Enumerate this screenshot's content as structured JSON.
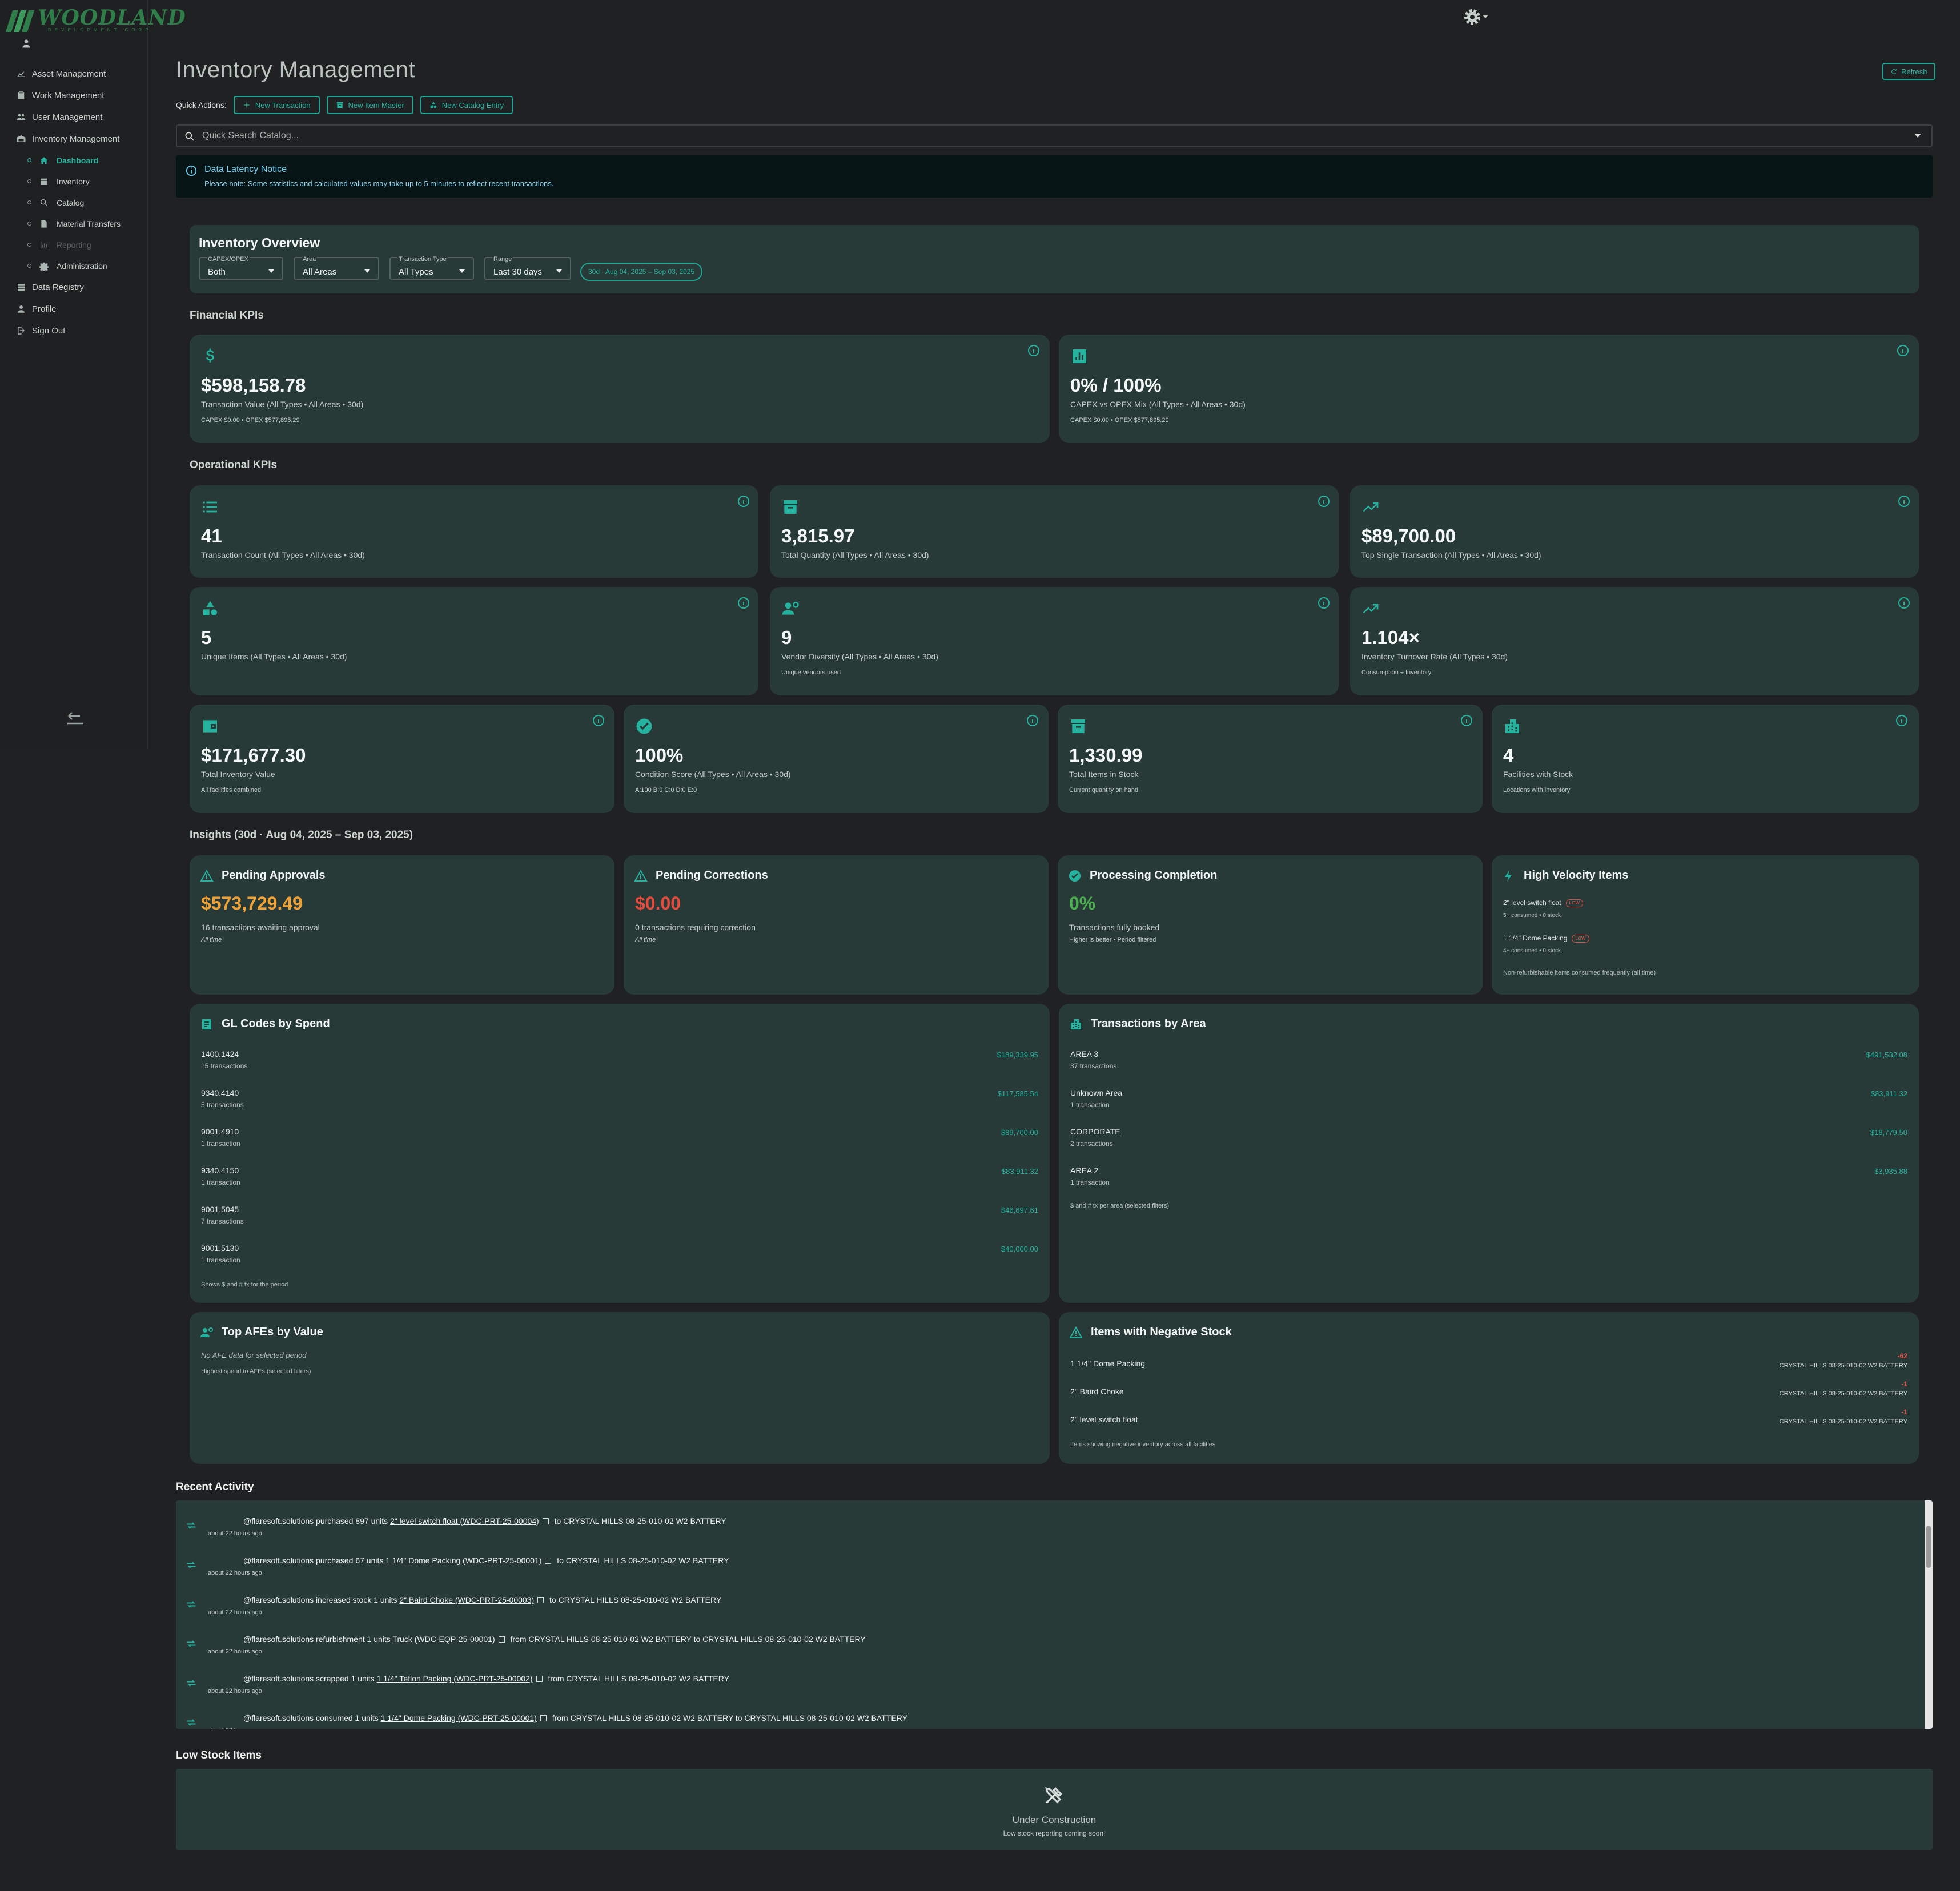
{
  "brand": {
    "name": "WOODLAND",
    "sub": "DEVELOPMENT CORP"
  },
  "sidebar": {
    "items": [
      {
        "label": "Asset Management",
        "icon": "asset-icon"
      },
      {
        "label": "Work Management",
        "icon": "clipboard-icon"
      },
      {
        "label": "User Management",
        "icon": "users-icon"
      },
      {
        "label": "Inventory Management",
        "icon": "warehouse-icon"
      }
    ],
    "sub": [
      {
        "label": "Dashboard",
        "icon": "home-icon",
        "state": "active"
      },
      {
        "label": "Inventory",
        "icon": "database-icon"
      },
      {
        "label": "Catalog",
        "icon": "search-icon"
      },
      {
        "label": "Material Transfers",
        "icon": "document-icon"
      },
      {
        "label": "Reporting",
        "icon": "chart-icon",
        "state": "disabled"
      },
      {
        "label": "Administration",
        "icon": "gear-icon"
      }
    ],
    "bottom": [
      {
        "label": "Data Registry",
        "icon": "database-icon"
      },
      {
        "label": "Profile",
        "icon": "user-icon"
      },
      {
        "label": "Sign Out",
        "icon": "logout-icon"
      }
    ]
  },
  "page": {
    "title": "Inventory Management",
    "refresh": "Refresh"
  },
  "quick_actions": {
    "label": "Quick Actions:",
    "buttons": [
      "New Transaction",
      "New Item Master",
      "New Catalog Entry"
    ]
  },
  "search": {
    "placeholder": "Quick Search Catalog..."
  },
  "notice": {
    "title": "Data Latency Notice",
    "text": "Please note: Some statistics and calculated values may take up to 5 minutes to reflect recent transactions."
  },
  "overview": {
    "title": "Inventory Overview",
    "filters": [
      {
        "label": "CAPEX/OPEX",
        "value": "Both"
      },
      {
        "label": "Area",
        "value": "All Areas"
      },
      {
        "label": "Transaction Type",
        "value": "All Types"
      },
      {
        "label": "Range",
        "value": "Last 30 days"
      }
    ],
    "chip": "30d · Aug 04, 2025 – Sep 03, 2025"
  },
  "sections": {
    "financial": "Financial KPIs",
    "operational": "Operational KPIs",
    "insights": "Insights (30d · Aug 04, 2025 – Sep 03, 2025)"
  },
  "financial": [
    {
      "value": "$598,158.78",
      "label": "Transaction Value (All Types • All Areas • 30d)",
      "sub": "CAPEX $0.00 • OPEX $577,895.29",
      "icon": "dollar-icon"
    },
    {
      "value": "0% / 100%",
      "label": "CAPEX vs OPEX Mix (All Types • All Areas • 30d)",
      "sub": "CAPEX $0.00 • OPEX $577,895.29",
      "icon": "bar-chart-icon"
    }
  ],
  "operational": [
    {
      "value": "41",
      "label": "Transaction Count (All Types • All Areas • 30d)",
      "sub": "",
      "icon": "list-icon"
    },
    {
      "value": "3,815.97",
      "label": "Total Quantity (All Types • All Areas • 30d)",
      "sub": "",
      "icon": "archive-icon"
    },
    {
      "value": "$89,700.00",
      "label": "Top Single Transaction (All Types • All Areas • 30d)",
      "sub": "",
      "icon": "trend-up-icon"
    },
    {
      "value": "5",
      "label": "Unique Items (All Types • All Areas • 30d)",
      "sub": "",
      "icon": "shapes-icon"
    },
    {
      "value": "9",
      "label": "Vendor Diversity (All Types • All Areas • 30d)",
      "sub": "Unique vendors used",
      "icon": "vendor-icon"
    },
    {
      "value": "1.104×",
      "label": "Inventory Turnover Rate (All Types • 30d)",
      "sub": "Consumption ÷ Inventory",
      "icon": "trend-up-icon"
    }
  ],
  "stock": [
    {
      "value": "$171,677.30",
      "label": "Total Inventory Value",
      "sub": "All facilities combined",
      "icon": "wallet-icon"
    },
    {
      "value": "100%",
      "label": "Condition Score (All Types • All Areas • 30d)",
      "sub": "A:100 B:0 C:0 D:0 E:0",
      "icon": "check-circle-icon"
    },
    {
      "value": "1,330.99",
      "label": "Total Items in Stock",
      "sub": "Current quantity on hand",
      "icon": "archive-icon"
    },
    {
      "value": "4",
      "label": "Facilities with Stock",
      "sub": "Locations with inventory",
      "icon": "buildings-icon"
    }
  ],
  "insights": {
    "pending_approvals": {
      "title": "Pending Approvals",
      "value": "$573,729.49",
      "line1": "16 transactions awaiting approval",
      "line2": "All time",
      "color": "#f2a135"
    },
    "pending_corrections": {
      "title": "Pending Corrections",
      "value": "$0.00",
      "line1": "0 transactions requiring correction",
      "line2": "All time",
      "color": "#e54b3f"
    },
    "processing": {
      "title": "Processing Completion",
      "value": "0%",
      "line1": "Transactions fully booked",
      "line2": "Higher is better • Period filtered",
      "color": "#4caf50"
    },
    "high_velocity": {
      "title": "High Velocity Items",
      "items": [
        {
          "name": "2\" level switch float",
          "badge": "LOW",
          "sub": "5+ consumed • 0 stock"
        },
        {
          "name": "1 1/4\" Dome Packing",
          "badge": "LOW",
          "sub": "4+ consumed • 0 stock"
        }
      ],
      "footer": "Non-refurbishable items consumed frequently (all time)"
    }
  },
  "gl_codes": {
    "title": "GL Codes by Spend",
    "rows": [
      {
        "code": "1400.1424",
        "count": "15 transactions",
        "value": "$189,339.95"
      },
      {
        "code": "9340.4140",
        "count": "5 transactions",
        "value": "$117,585.54"
      },
      {
        "code": "9001.4910",
        "count": "1 transaction",
        "value": "$89,700.00"
      },
      {
        "code": "9340.4150",
        "count": "1 transaction",
        "value": "$83,911.32"
      },
      {
        "code": "9001.5045",
        "count": "7 transactions",
        "value": "$46,697.61"
      },
      {
        "code": "9001.5130",
        "count": "1 transaction",
        "value": "$40,000.00"
      }
    ],
    "footer": "Shows $ and # tx for the period"
  },
  "areas": {
    "title": "Transactions by Area",
    "rows": [
      {
        "code": "AREA 3",
        "count": "37 transactions",
        "value": "$491,532.08"
      },
      {
        "code": "Unknown Area",
        "count": "1 transaction",
        "value": "$83,911.32"
      },
      {
        "code": "CORPORATE",
        "count": "2 transactions",
        "value": "$18,779.50"
      },
      {
        "code": "AREA 2",
        "count": "1 transaction",
        "value": "$3,935.88"
      }
    ],
    "footer": "$ and # tx per area (selected filters)"
  },
  "afes": {
    "title": "Top AFEs by Value",
    "empty": "No AFE data for selected period",
    "footer": "Highest spend to AFEs (selected filters)"
  },
  "negative": {
    "title": "Items with Negative Stock",
    "rows": [
      {
        "name": "1 1/4\" Dome Packing",
        "qty": "-62",
        "facility": "CRYSTAL HILLS 08-25-010-02 W2 BATTERY"
      },
      {
        "name": "2\" Baird Choke",
        "qty": "-1",
        "facility": "CRYSTAL HILLS 08-25-010-02 W2 BATTERY"
      },
      {
        "name": "2\" level switch float",
        "qty": "-1",
        "facility": "CRYSTAL HILLS 08-25-010-02 W2 BATTERY"
      }
    ],
    "footer": "Items showing negative inventory across all facilities"
  },
  "recent": {
    "title": "Recent Activity",
    "items": [
      {
        "pre": "@flaresoft.solutions purchased 897 units ",
        "link": "2\" level switch float (WDC-PRT-25-00004)",
        "post": " to CRYSTAL HILLS 08-25-010-02 W2 BATTERY",
        "ago": "about 22 hours ago"
      },
      {
        "pre": "@flaresoft.solutions purchased 67 units ",
        "link": "1 1/4\" Dome Packing (WDC-PRT-25-00001)",
        "post": " to CRYSTAL HILLS 08-25-010-02 W2 BATTERY",
        "ago": "about 22 hours ago"
      },
      {
        "pre": "@flaresoft.solutions increased stock 1 units ",
        "link": "2\" Baird Choke (WDC-PRT-25-00003)",
        "post": " to CRYSTAL HILLS 08-25-010-02 W2 BATTERY",
        "ago": "about 22 hours ago"
      },
      {
        "pre": "@flaresoft.solutions refurbishment 1 units ",
        "link": "Truck (WDC-EQP-25-00001)",
        "post": " from CRYSTAL HILLS 08-25-010-02 W2 BATTERY to CRYSTAL HILLS 08-25-010-02 W2 BATTERY",
        "ago": "about 22 hours ago"
      },
      {
        "pre": "@flaresoft.solutions scrapped 1 units ",
        "link": "1 1/4\" Teflon Packing (WDC-PRT-25-00002)",
        "post": " from CRYSTAL HILLS 08-25-010-02 W2 BATTERY",
        "ago": "about 22 hours ago"
      },
      {
        "pre": "@flaresoft.solutions consumed 1 units ",
        "link": "1 1/4\" Dome Packing (WDC-PRT-25-00001)",
        "post": " from CRYSTAL HILLS 08-25-010-02 W2 BATTERY to CRYSTAL HILLS 08-25-010-02 W2 BATTERY",
        "ago": "about 22 hours ago"
      }
    ]
  },
  "low_stock": {
    "title": "Low Stock Items",
    "status": "Under Construction",
    "text": "Low stock reporting coming soon!"
  }
}
